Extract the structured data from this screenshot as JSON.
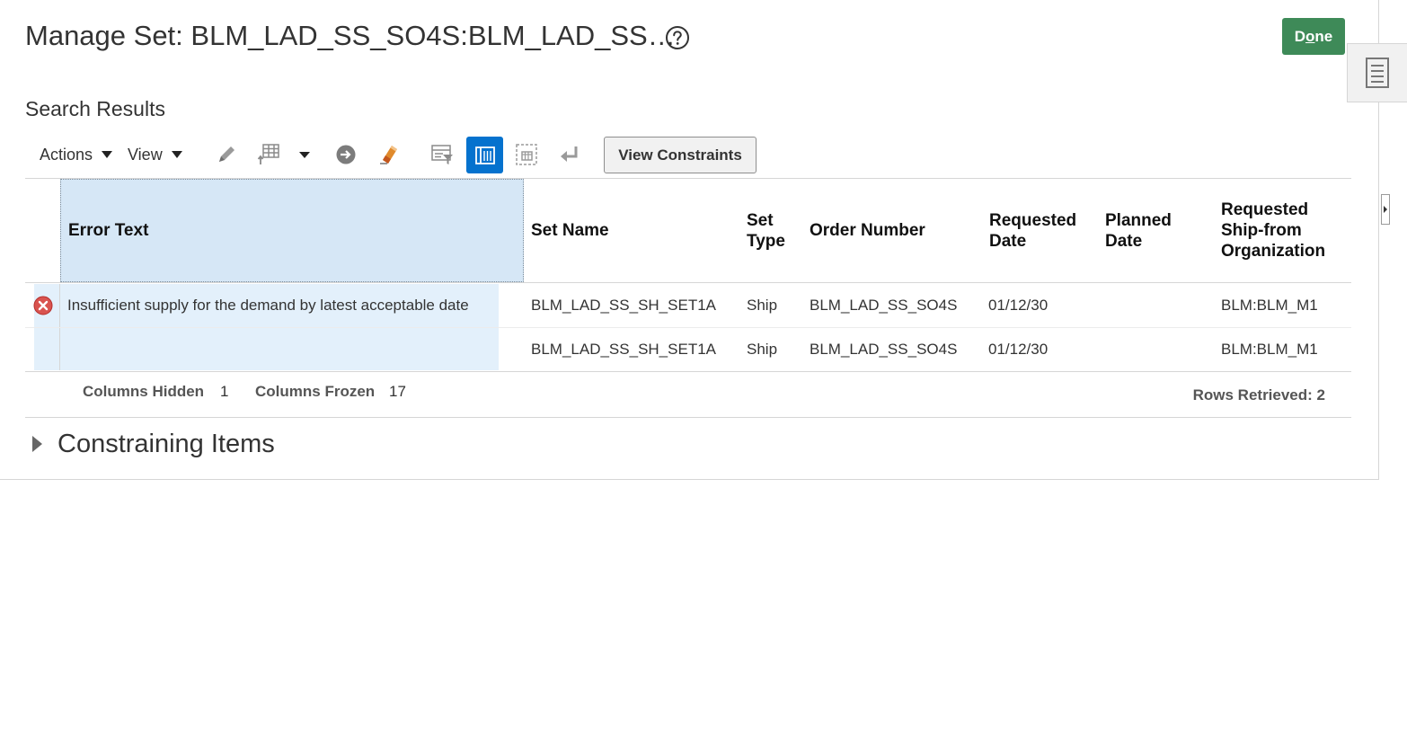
{
  "header": {
    "title": "Manage Set: BLM_LAD_SS_SO4S:BLM_LAD_SS…",
    "help_icon": "help-circle-icon",
    "done_label": "Done",
    "done_color": "#3e8a58"
  },
  "section_title": "Search Results",
  "toolbar": {
    "actions_label": "Actions",
    "view_label": "View",
    "icons": [
      "edit-icon",
      "format-table-icon",
      "dropdown-arrow-icon",
      "go-icon",
      "clear-icon",
      "query-by-example-icon",
      "freeze-columns-icon",
      "detach-icon",
      "wrap-icon"
    ],
    "view_constraints_label": "View Constraints"
  },
  "table": {
    "columns": [
      "Error Text",
      "Set Name",
      "Set Type",
      "Order Number",
      "Requested Date",
      "Planned Date",
      "Requested Ship-from Organization"
    ],
    "rows": [
      {
        "status_icon": "error-icon",
        "error_text": "Insufficient supply for the demand by latest acceptable date",
        "set_name": "BLM_LAD_SS_SH_SET1A",
        "set_type": "Ship",
        "order_number": "BLM_LAD_SS_SO4S",
        "requested_date": "01/12/30",
        "planned_date": "",
        "ship_from_org": "BLM:BLM_M1"
      },
      {
        "status_icon": "",
        "error_text": "",
        "set_name": "BLM_LAD_SS_SH_SET1A",
        "set_type": "Ship",
        "order_number": "BLM_LAD_SS_SO4S",
        "requested_date": "01/12/30",
        "planned_date": "",
        "ship_from_org": "BLM:BLM_M1"
      }
    ]
  },
  "footer": {
    "columns_hidden_label": "Columns Hidden",
    "columns_hidden_value": "1",
    "columns_frozen_label": "Columns Frozen",
    "columns_frozen_value": "17",
    "rows_retrieved": "Rows Retrieved: 2"
  },
  "constraining_items": {
    "label": "Constraining Items",
    "expanded": false
  }
}
